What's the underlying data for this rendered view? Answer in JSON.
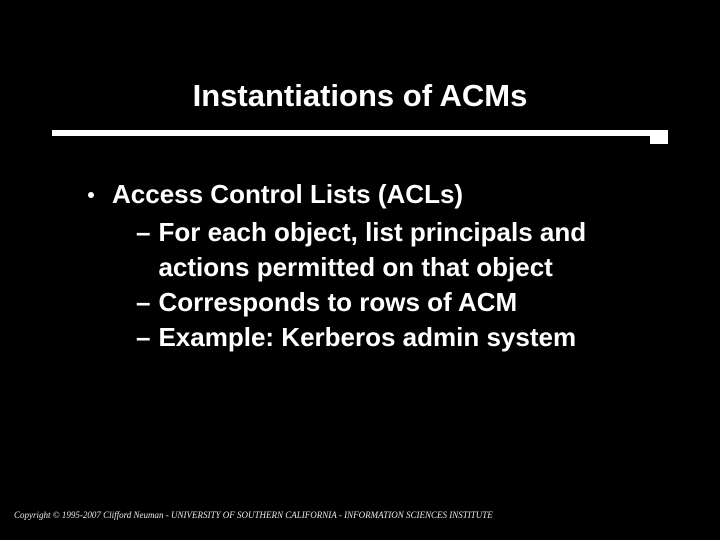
{
  "title": "Instantiations of ACMs",
  "bullets": [
    {
      "text": "Access Control Lists (ACLs)",
      "subs": [
        "For each object, list principals and actions permitted on that object",
        "Corresponds to rows of ACM",
        "Example: Kerberos admin system"
      ]
    }
  ],
  "footer": "Copyright © 1995-2007 Clifford Neuman - UNIVERSITY OF SOUTHERN CALIFORNIA - INFORMATION SCIENCES INSTITUTE"
}
